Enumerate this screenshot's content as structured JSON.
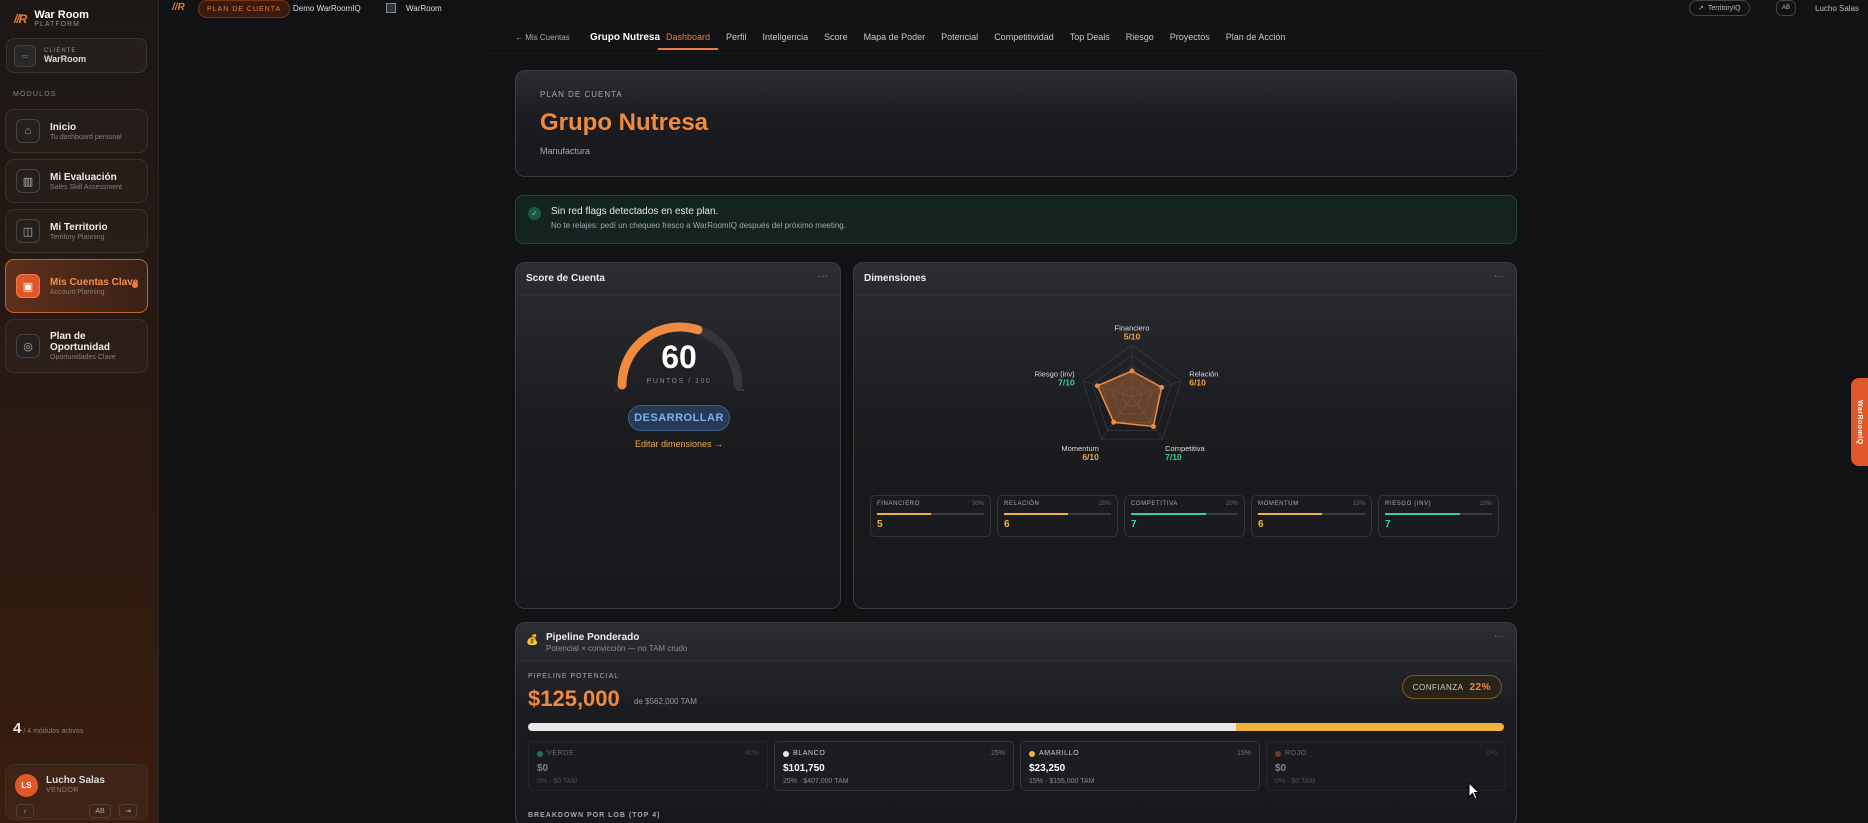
{
  "brand": {
    "title": "War Room",
    "subtitle": "PLATFORM"
  },
  "client": {
    "label": "CLIENTE",
    "name": "WarRoom"
  },
  "sidebar": {
    "modules_title": "MÓDULOS",
    "items": [
      {
        "title": "Inicio",
        "sub": "Tu dashboard personal",
        "icon": "home-icon"
      },
      {
        "title": "Mi Evaluación",
        "sub": "Sales Skill Assessment",
        "icon": "chart-icon"
      },
      {
        "title": "Mi Territorio",
        "sub": "Territory Planning",
        "icon": "map-icon"
      },
      {
        "title": "Mis Cuentas Clave",
        "sub": "Account Planning",
        "icon": "briefcase-icon"
      },
      {
        "title": "Plan de Oportunidad",
        "sub": "Oportunidades Clave",
        "icon": "target-icon"
      }
    ],
    "active_count": "4",
    "active_text": "/ 4 módulos activos"
  },
  "user": {
    "initials": "LS",
    "name": "Lucho Salas",
    "role": "VENDOR",
    "ab": "AB"
  },
  "topbar": {
    "pill": "PLAN DE CUENTA",
    "demo": "Demo WarRoomIQ",
    "workspace": "WarRoom",
    "territory": "TerritoryIQ",
    "ab": "AB",
    "user": "Lucho Salas"
  },
  "subnav": {
    "back": "← Mis Cuentas",
    "title": "Grupo Nutresa",
    "tabs": [
      "Dashboard",
      "Perfil",
      "Inteligencia",
      "Score",
      "Mapa de Poder",
      "Potencial",
      "Competitividad",
      "Top Deals",
      "Riesgo",
      "Proyectos",
      "Plan de Acción"
    ]
  },
  "hero": {
    "kicker": "PLAN DE CUENTA",
    "title": "Grupo Nutresa",
    "industry": "Manufactura"
  },
  "notice": {
    "title": "Sin red flags detectados en este plan.",
    "text": "No te relajes: pedí un chequeo fresco a WarRoomIQ después del próximo meeting."
  },
  "score": {
    "title": "Score de Cuenta",
    "value": "60",
    "value_num": 60,
    "unit": "PUNTOS / 100",
    "min": "0",
    "max": "100",
    "button": "DESARROLLAR",
    "edit_link": "Editar dimensiones →"
  },
  "dimensions": {
    "title": "Dimensiones",
    "radar": [
      {
        "label": "Financiero",
        "score": "5/10",
        "value": 5,
        "color": "#f0a84a"
      },
      {
        "label": "Relación",
        "score": "6/10",
        "value": 6,
        "color": "#f0a84a"
      },
      {
        "label": "Competitiva",
        "score": "7/10",
        "value": 7,
        "color": "#34d399"
      },
      {
        "label": "Momentum",
        "score": "6/10",
        "value": 6,
        "color": "#f0a84a"
      },
      {
        "label": "Riesgo (inv)",
        "score": "7/10",
        "value": 7,
        "color": "#34d399"
      }
    ],
    "boxes": [
      {
        "name": "FINANCIERO",
        "weight": "30%",
        "value": "5",
        "fill": 0.5,
        "color": "#f0b43c"
      },
      {
        "name": "RELACIÓN",
        "weight": "25%",
        "value": "6",
        "fill": 0.6,
        "color": "#f0b43c"
      },
      {
        "name": "COMPETITIVA",
        "weight": "20%",
        "value": "7",
        "fill": 0.7,
        "color": "#34d399"
      },
      {
        "name": "MOMENTUM",
        "weight": "15%",
        "value": "6",
        "fill": 0.6,
        "color": "#f0b43c"
      },
      {
        "name": "RIESGO (INV)",
        "weight": "10%",
        "value": "7",
        "fill": 0.7,
        "color": "#34d399"
      }
    ]
  },
  "pipeline": {
    "title": "Pipeline Ponderado",
    "subtitle": "Potencial × convicción — no TAM crudo",
    "kicker": "PIPELINE POTENCIAL",
    "amount": "$125,000",
    "tam": "de $562,000 TAM",
    "confidence_label": "CONFIANZA",
    "confidence_value": "22%",
    "bar": [
      {
        "name": "blanco",
        "fraction": 0.725,
        "color": "#e8e8e8"
      },
      {
        "name": "amarillo",
        "fraction": 0.275,
        "color": "#f0b43c"
      }
    ],
    "segments": [
      {
        "name": "VERDE",
        "pct": "40%",
        "value": "$0",
        "detail": "0% · $0 TAM",
        "color": "#34d399",
        "dim": true
      },
      {
        "name": "BLANCO",
        "pct": "25%",
        "value": "$101,750",
        "detail": "25% · $407,000 TAM",
        "color": "#e8e8e8",
        "dim": false
      },
      {
        "name": "AMARILLO",
        "pct": "15%",
        "value": "$23,250",
        "detail": "15% · $155,000 TAM",
        "color": "#f0b43c",
        "dim": false
      },
      {
        "name": "ROJO",
        "pct": "0%",
        "value": "$0",
        "detail": "0% · $0 TAM",
        "color": "#e05a4a",
        "dim": true
      }
    ],
    "lob_title": "BREAKDOWN POR LOB (TOP 4)"
  },
  "side_tab": "WarRoomIQ"
}
